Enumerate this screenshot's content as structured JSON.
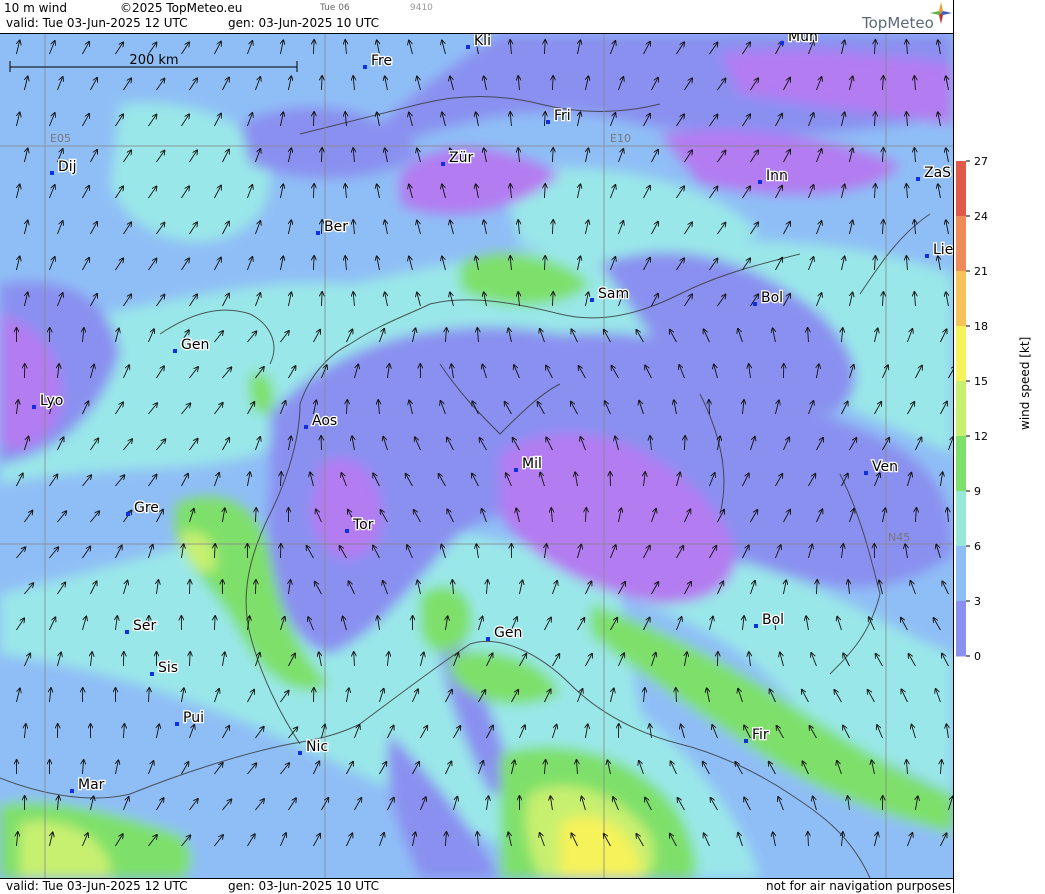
{
  "header": {
    "product": "10 m wind",
    "copyright": "©2025 TopMeteo.eu",
    "small_day": "Tue 06",
    "small_code": "9410",
    "valid": "valid:  Tue  03-Jun-2025  12 UTC",
    "gen": "gen: 03-Jun-2025 10 UTC",
    "logo": "TopMeteo"
  },
  "footer": {
    "valid": "valid:  Tue  03-Jun-2025  12 UTC",
    "gen": "gen: 03-Jun-2025 10 UTC",
    "disclaimer": "not for air navigation purposes"
  },
  "map": {
    "scale_label": "200 km",
    "grid_labels": [
      "E05",
      "E10",
      "N45"
    ],
    "cities": [
      "Fre",
      "Kli",
      "Mün",
      "Fri",
      "Dij",
      "Zür",
      "Inn",
      "ZaS",
      "Ber",
      "Lie",
      "Sam",
      "Bol",
      "Gen",
      "Lyo",
      "Aos",
      "Mil",
      "Ven",
      "Gre",
      "Tor",
      "Ser",
      "Gen",
      "Bol",
      "Sis",
      "Pui",
      "Nic",
      "Fir",
      "Mar"
    ]
  },
  "colorbar": {
    "title": "wind speed [kt]",
    "ticks": [
      "27",
      "24",
      "21",
      "18",
      "15",
      "12",
      "9",
      "6",
      "3",
      "0"
    ],
    "colors": [
      "#e05a4a",
      "#ef8a5a",
      "#f6c35a",
      "#f6f25a",
      "#c8f070",
      "#7ee06a",
      "#98e8d8",
      "#8fbef6",
      "#8a90f0",
      "#b37cf0"
    ]
  }
}
